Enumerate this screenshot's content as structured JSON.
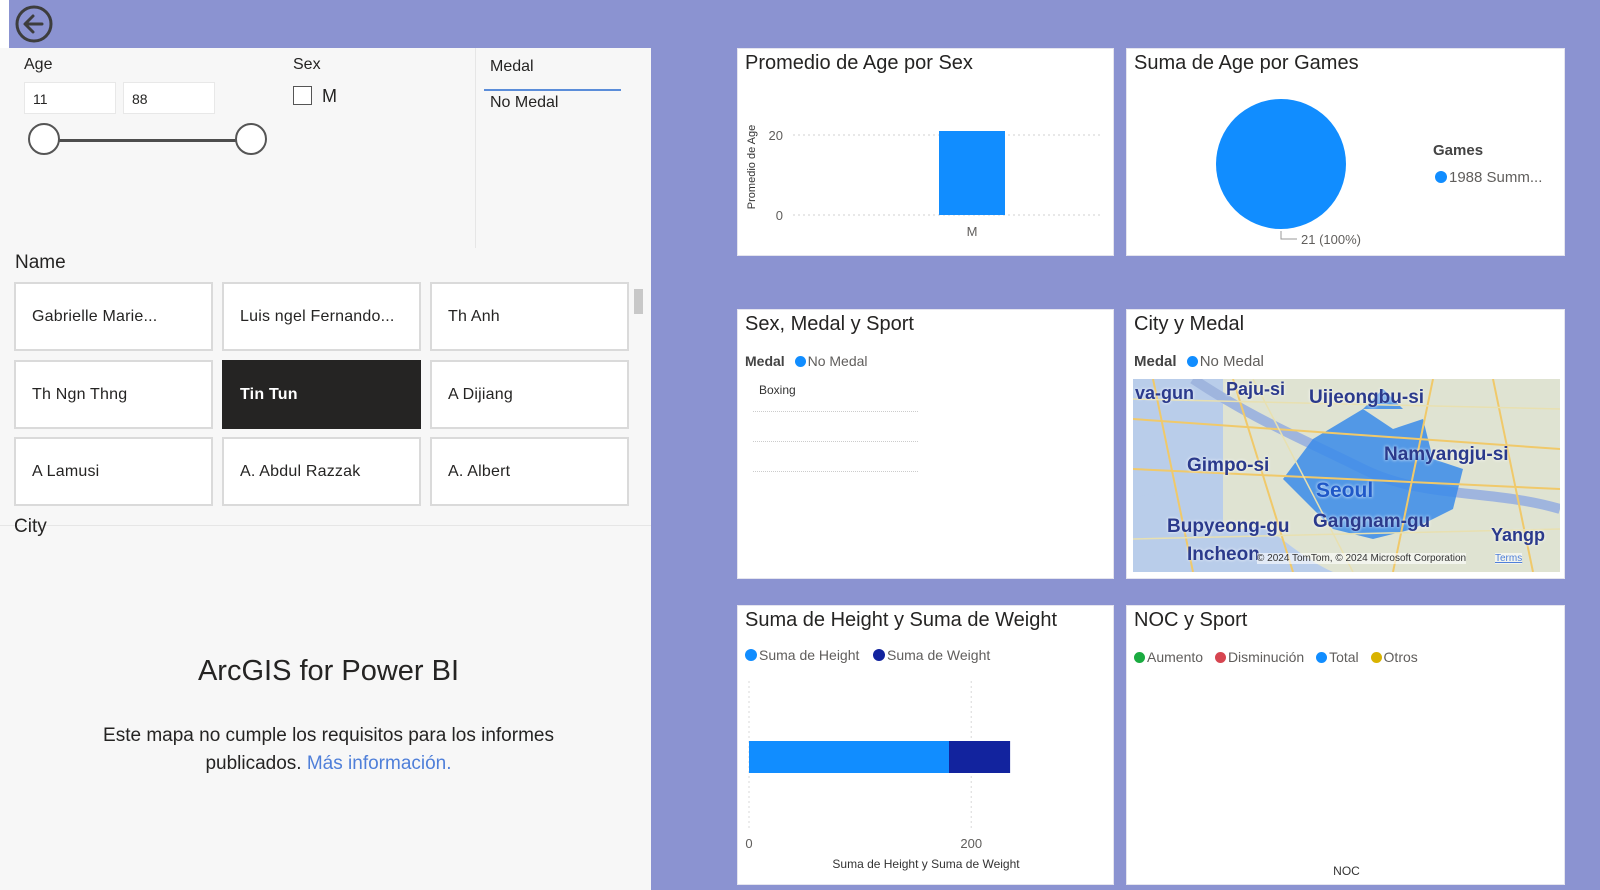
{
  "colors": {
    "canvas": "#8b93d1",
    "primary": "#118dff",
    "dark_blue": "#12239e",
    "selected_tile": "#252423",
    "link": "#4f7fd9",
    "aumento": "#1aab40",
    "disminucion": "#d64550",
    "otros": "#d9b300"
  },
  "navigation": {
    "back_icon": "back-arrow-icon"
  },
  "filters": {
    "age": {
      "label": "Age",
      "min": "11",
      "max": "88"
    },
    "sex": {
      "label": "Sex",
      "option": "M"
    },
    "medal": {
      "header": "Medal",
      "item": "No Medal"
    }
  },
  "name_slicer": {
    "label": "Name",
    "names": [
      "Gabrielle Marie...",
      "Luis ngel Fernando...",
      "Th Anh",
      "Th Ngn Thng",
      "Tin Tun",
      "A Dijiang",
      "A Lamusi",
      "A. Abdul Razzak",
      "A. Albert"
    ],
    "selected": "Tin Tun"
  },
  "city_slicer": {
    "label": "City"
  },
  "arcgis": {
    "title": "ArcGIS for Power BI",
    "message_line1": "Este mapa no cumple los requisitos para los informes",
    "message_line2": "publicados.",
    "link": "Más información."
  },
  "visuals": {
    "age_by_sex": {
      "title": "Promedio de Age por Sex"
    },
    "age_by_games": {
      "title": "Suma de Age por Games"
    },
    "sex_medal_sport": {
      "title": "Sex, Medal y Sport",
      "legend_title": "Medal",
      "legend_item": "No Medal",
      "row_label": "Boxing"
    },
    "city_medal": {
      "title": "City y Medal",
      "legend_title": "Medal",
      "legend_item": "No Medal",
      "places": [
        "va-gun",
        "Paju-si",
        "Uijeongbu-si",
        "Namyangju-si",
        "Gimpo-si",
        "Seoul",
        "Bupyeong-gu",
        "Gangnam-gu",
        "Incheon",
        "Yangp"
      ],
      "copyright": "© 2024 TomTom, © 2024 Microsoft Corporation",
      "terms": "Terms"
    },
    "height_weight": {
      "title": "Suma de Height y Suma de Weight"
    },
    "noc_sport": {
      "title": "NOC y Sport",
      "legend": [
        "Aumento",
        "Disminución",
        "Total",
        "Otros"
      ],
      "xlabel": "NOC"
    }
  },
  "chart_data": [
    {
      "type": "bar",
      "title": "Promedio de Age por Sex",
      "categories": [
        "M"
      ],
      "values": [
        21
      ],
      "ylabel": "Promedio de Age",
      "xlabel": "",
      "ylim": [
        0,
        22
      ],
      "yticks": [
        "0",
        "20"
      ],
      "grid": true
    },
    {
      "type": "pie",
      "title": "Suma de Age por Games",
      "legend_title": "Games",
      "categories": [
        "1988 Summ..."
      ],
      "values": [
        21
      ],
      "data_labels": [
        "21 (100%)"
      ],
      "legend_position": "right"
    },
    {
      "type": "bar",
      "orientation": "horizontal-stacked",
      "title": "Suma de Height y Suma de Weight",
      "series": [
        {
          "name": "Suma de Height",
          "values": [
            180
          ]
        },
        {
          "name": "Suma de Weight",
          "values": [
            55
          ]
        }
      ],
      "xlabel": "Suma de Height y Suma de Weight",
      "xlim": [
        0,
        270
      ],
      "xticks": [
        "0",
        "200"
      ],
      "legend_position": "top-left"
    }
  ]
}
